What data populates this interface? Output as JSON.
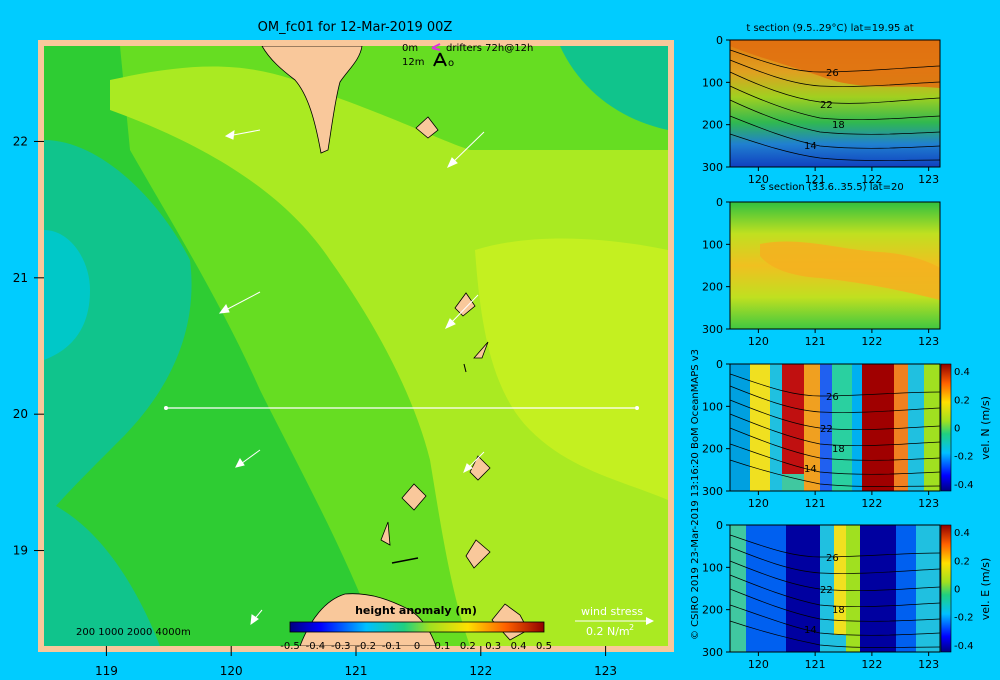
{
  "colors": {
    "background": "#00ccff",
    "frame": "#f9c89b",
    "land": "#f9c89b",
    "sea_light": "#aaea22",
    "sea_mid": "#66dd22",
    "sea_green": "#2ecc33",
    "sea_teal": "#10c48c",
    "sea_cyan": "#00c8c8",
    "section_line": "#ffffff"
  },
  "main_map": {
    "title": "OM_fc01 for 12-Mar-2019 00Z",
    "xticks": [
      "119",
      "120",
      "121",
      "122",
      "123"
    ],
    "yticks": [
      "22",
      "21",
      "20",
      "19"
    ],
    "drifters": {
      "line1_depth": "0m",
      "line1_text": "drifters 72h@12h",
      "line2_depth": "12m",
      "line2_text": "o"
    },
    "depth_scale": "200  1000  2000  4000m",
    "wind_stress": {
      "label": "wind stress",
      "value_label": "0.2 N/m",
      "exponent": "2"
    },
    "colorbar": {
      "title": "height anomaly (m)",
      "ticks": [
        "-0.5",
        "-0.4",
        "-0.3",
        "-0.2",
        "-0.1",
        "0",
        "0.1",
        "0.2",
        "0.3",
        "0.4",
        "0.5"
      ]
    },
    "section_line_lat": "20"
  },
  "side_label": "© CSIRO 2019   23-Mar-2019 13:16:20 BoM OceanMAPS v3",
  "panels": {
    "t": {
      "title": "t section (9.5..29°C) lat=19.95 at",
      "contours": [
        "26",
        "22",
        "18",
        "14"
      ],
      "xticks": [
        "120",
        "121",
        "122",
        "123"
      ],
      "yticks": [
        "0",
        "100",
        "200",
        "300"
      ]
    },
    "s": {
      "title": "s section (33.6..35.5) lat=20",
      "xticks": [
        "120",
        "121",
        "122",
        "123"
      ],
      "yticks": [
        "0",
        "100",
        "200",
        "300"
      ]
    },
    "vn": {
      "contours": [
        "26",
        "22",
        "18",
        "14"
      ],
      "xticks": [
        "120",
        "121",
        "122",
        "123"
      ],
      "yticks": [
        "0",
        "100",
        "200",
        "300"
      ],
      "cbar_ticks": [
        "0.4",
        "0.2",
        "0",
        "-0.2",
        "-0.4"
      ],
      "cbar_label": "vel. N (m/s)"
    },
    "ve": {
      "contours": [
        "26",
        "22",
        "18",
        "14"
      ],
      "xticks": [
        "120",
        "121",
        "122",
        "123"
      ],
      "yticks": [
        "0",
        "100",
        "200",
        "300"
      ],
      "cbar_ticks": [
        "0.4",
        "0.2",
        "0",
        "-0.2",
        "-0.4"
      ],
      "cbar_label": "vel. E (m/s)"
    }
  },
  "chart_data": [
    {
      "type": "heatmap",
      "title": "OM_fc01 for 12-Mar-2019 00Z",
      "xlabel": "",
      "ylabel": "",
      "xlim": [
        118.5,
        123.5
      ],
      "ylim": [
        18.3,
        22.7
      ],
      "colorbar_title": "height anomaly (m)",
      "colorbar_range": [
        -0.5,
        0.5
      ],
      "section_line": {
        "lat": 20,
        "lon": [
          119.5,
          123.2
        ]
      },
      "wind_stress_arrows": [
        {
          "lon": 120.0,
          "lat": 22.0,
          "dir": "W"
        },
        {
          "lon": 121.9,
          "lat": 21.8,
          "dir": "SW"
        },
        {
          "lon": 120.0,
          "lat": 20.7,
          "dir": "SW"
        },
        {
          "lon": 121.8,
          "lat": 20.6,
          "dir": "SW"
        },
        {
          "lon": 120.1,
          "lat": 19.6,
          "dir": "SW"
        },
        {
          "lon": 121.9,
          "lat": 19.6,
          "dir": "SW"
        },
        {
          "lon": 120.2,
          "lat": 18.5,
          "dir": "SW"
        }
      ]
    },
    {
      "type": "heatmap",
      "title": "t section (9.5..29°C) lat=19.95 at",
      "xlim": [
        119.5,
        123.2
      ],
      "ylim": [
        300,
        0
      ],
      "value_range": [
        9.5,
        29
      ],
      "contour_levels": [
        26,
        22,
        18,
        14
      ]
    },
    {
      "type": "heatmap",
      "title": "s section (33.6..35.5) lat=20",
      "xlim": [
        119.5,
        123.2
      ],
      "ylim": [
        300,
        0
      ],
      "value_range": [
        33.6,
        35.5
      ]
    },
    {
      "type": "heatmap",
      "title": "vel. N (m/s)",
      "xlim": [
        119.5,
        123.2
      ],
      "ylim": [
        300,
        0
      ],
      "colorbar_range": [
        -0.4,
        0.4
      ],
      "contour_levels": [
        26,
        22,
        18,
        14
      ]
    },
    {
      "type": "heatmap",
      "title": "vel. E (m/s)",
      "xlim": [
        119.5,
        123.2
      ],
      "ylim": [
        300,
        0
      ],
      "colorbar_range": [
        -0.4,
        0.4
      ],
      "contour_levels": [
        26,
        22,
        18,
        14
      ]
    }
  ]
}
